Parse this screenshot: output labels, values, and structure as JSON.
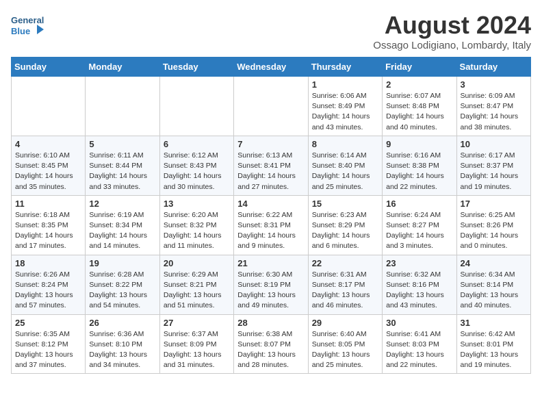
{
  "logo": {
    "line1": "General",
    "line2": "Blue"
  },
  "title": "August 2024",
  "subtitle": "Ossago Lodigiano, Lombardy, Italy",
  "weekdays": [
    "Sunday",
    "Monday",
    "Tuesday",
    "Wednesday",
    "Thursday",
    "Friday",
    "Saturday"
  ],
  "weeks": [
    [
      {
        "day": "",
        "info": ""
      },
      {
        "day": "",
        "info": ""
      },
      {
        "day": "",
        "info": ""
      },
      {
        "day": "",
        "info": ""
      },
      {
        "day": "1",
        "info": "Sunrise: 6:06 AM\nSunset: 8:49 PM\nDaylight: 14 hours\nand 43 minutes."
      },
      {
        "day": "2",
        "info": "Sunrise: 6:07 AM\nSunset: 8:48 PM\nDaylight: 14 hours\nand 40 minutes."
      },
      {
        "day": "3",
        "info": "Sunrise: 6:09 AM\nSunset: 8:47 PM\nDaylight: 14 hours\nand 38 minutes."
      }
    ],
    [
      {
        "day": "4",
        "info": "Sunrise: 6:10 AM\nSunset: 8:45 PM\nDaylight: 14 hours\nand 35 minutes."
      },
      {
        "day": "5",
        "info": "Sunrise: 6:11 AM\nSunset: 8:44 PM\nDaylight: 14 hours\nand 33 minutes."
      },
      {
        "day": "6",
        "info": "Sunrise: 6:12 AM\nSunset: 8:43 PM\nDaylight: 14 hours\nand 30 minutes."
      },
      {
        "day": "7",
        "info": "Sunrise: 6:13 AM\nSunset: 8:41 PM\nDaylight: 14 hours\nand 27 minutes."
      },
      {
        "day": "8",
        "info": "Sunrise: 6:14 AM\nSunset: 8:40 PM\nDaylight: 14 hours\nand 25 minutes."
      },
      {
        "day": "9",
        "info": "Sunrise: 6:16 AM\nSunset: 8:38 PM\nDaylight: 14 hours\nand 22 minutes."
      },
      {
        "day": "10",
        "info": "Sunrise: 6:17 AM\nSunset: 8:37 PM\nDaylight: 14 hours\nand 19 minutes."
      }
    ],
    [
      {
        "day": "11",
        "info": "Sunrise: 6:18 AM\nSunset: 8:35 PM\nDaylight: 14 hours\nand 17 minutes."
      },
      {
        "day": "12",
        "info": "Sunrise: 6:19 AM\nSunset: 8:34 PM\nDaylight: 14 hours\nand 14 minutes."
      },
      {
        "day": "13",
        "info": "Sunrise: 6:20 AM\nSunset: 8:32 PM\nDaylight: 14 hours\nand 11 minutes."
      },
      {
        "day": "14",
        "info": "Sunrise: 6:22 AM\nSunset: 8:31 PM\nDaylight: 14 hours\nand 9 minutes."
      },
      {
        "day": "15",
        "info": "Sunrise: 6:23 AM\nSunset: 8:29 PM\nDaylight: 14 hours\nand 6 minutes."
      },
      {
        "day": "16",
        "info": "Sunrise: 6:24 AM\nSunset: 8:27 PM\nDaylight: 14 hours\nand 3 minutes."
      },
      {
        "day": "17",
        "info": "Sunrise: 6:25 AM\nSunset: 8:26 PM\nDaylight: 14 hours\nand 0 minutes."
      }
    ],
    [
      {
        "day": "18",
        "info": "Sunrise: 6:26 AM\nSunset: 8:24 PM\nDaylight: 13 hours\nand 57 minutes."
      },
      {
        "day": "19",
        "info": "Sunrise: 6:28 AM\nSunset: 8:22 PM\nDaylight: 13 hours\nand 54 minutes."
      },
      {
        "day": "20",
        "info": "Sunrise: 6:29 AM\nSunset: 8:21 PM\nDaylight: 13 hours\nand 51 minutes."
      },
      {
        "day": "21",
        "info": "Sunrise: 6:30 AM\nSunset: 8:19 PM\nDaylight: 13 hours\nand 49 minutes."
      },
      {
        "day": "22",
        "info": "Sunrise: 6:31 AM\nSunset: 8:17 PM\nDaylight: 13 hours\nand 46 minutes."
      },
      {
        "day": "23",
        "info": "Sunrise: 6:32 AM\nSunset: 8:16 PM\nDaylight: 13 hours\nand 43 minutes."
      },
      {
        "day": "24",
        "info": "Sunrise: 6:34 AM\nSunset: 8:14 PM\nDaylight: 13 hours\nand 40 minutes."
      }
    ],
    [
      {
        "day": "25",
        "info": "Sunrise: 6:35 AM\nSunset: 8:12 PM\nDaylight: 13 hours\nand 37 minutes."
      },
      {
        "day": "26",
        "info": "Sunrise: 6:36 AM\nSunset: 8:10 PM\nDaylight: 13 hours\nand 34 minutes."
      },
      {
        "day": "27",
        "info": "Sunrise: 6:37 AM\nSunset: 8:09 PM\nDaylight: 13 hours\nand 31 minutes."
      },
      {
        "day": "28",
        "info": "Sunrise: 6:38 AM\nSunset: 8:07 PM\nDaylight: 13 hours\nand 28 minutes."
      },
      {
        "day": "29",
        "info": "Sunrise: 6:40 AM\nSunset: 8:05 PM\nDaylight: 13 hours\nand 25 minutes."
      },
      {
        "day": "30",
        "info": "Sunrise: 6:41 AM\nSunset: 8:03 PM\nDaylight: 13 hours\nand 22 minutes."
      },
      {
        "day": "31",
        "info": "Sunrise: 6:42 AM\nSunset: 8:01 PM\nDaylight: 13 hours\nand 19 minutes."
      }
    ]
  ]
}
